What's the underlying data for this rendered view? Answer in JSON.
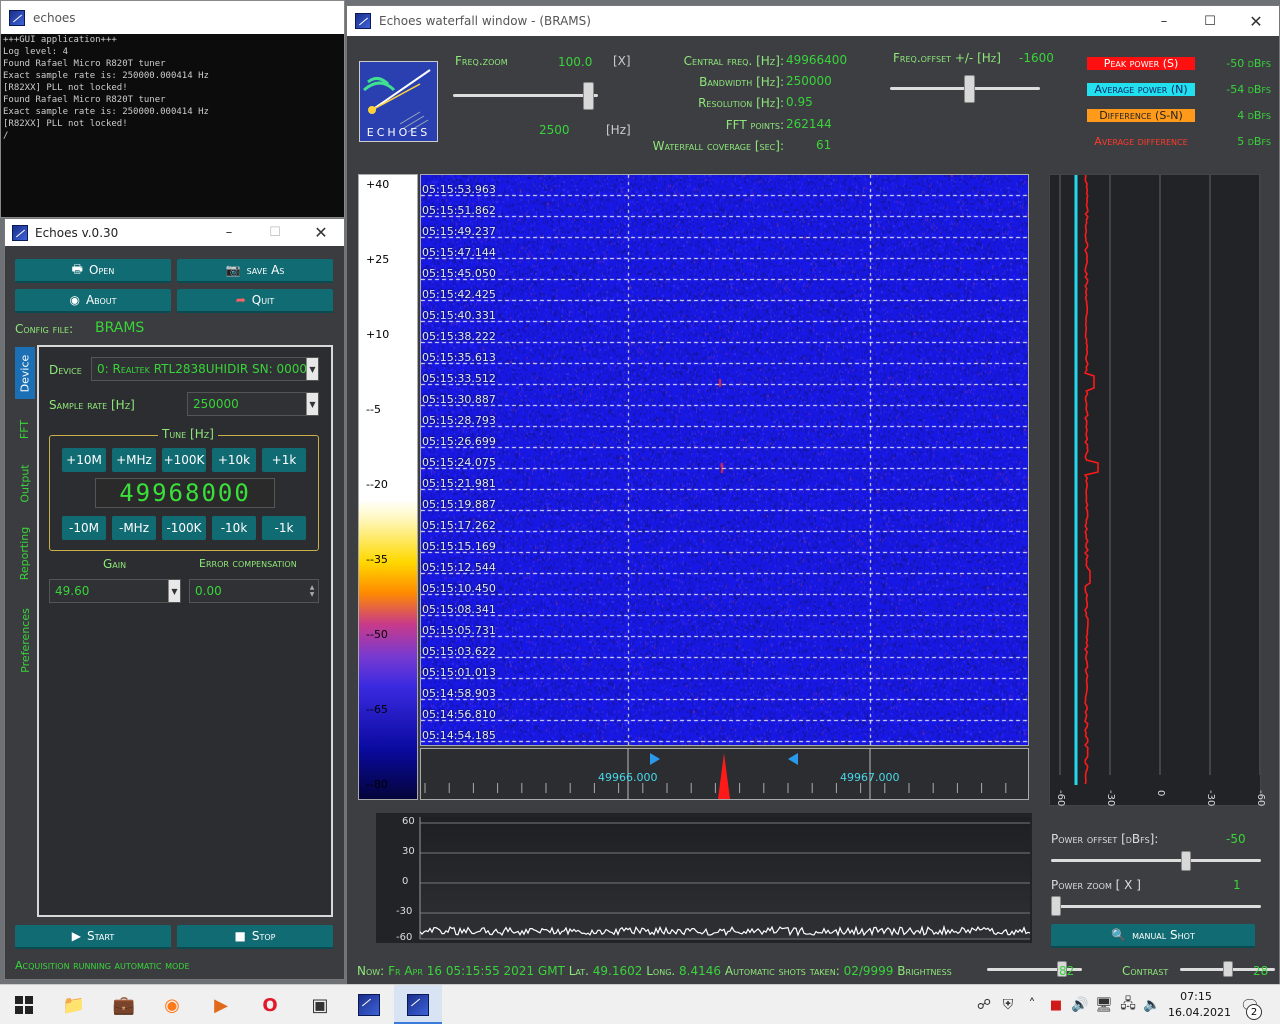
{
  "console": {
    "title": "echoes",
    "lines": [
      "+++GUI application+++",
      "Log level: 4",
      "Found Rafael Micro R820T tuner",
      "Exact sample rate is: 250000.000414 Hz",
      "[R82XX] PLL not locked!",
      "Found Rafael Micro R820T tuner",
      "Exact sample rate is: 250000.000414 Hz",
      "[R82XX] PLL not locked!",
      "/"
    ]
  },
  "control": {
    "title": "Echoes v.0.30",
    "open_label": "Open",
    "saveas_label": "save As",
    "about_label": "About",
    "quit_label": "Quit",
    "config_label": "Config file:",
    "config_value": "BRAMS",
    "tabs": [
      "Device",
      "FFT",
      "Output",
      "Reporting",
      "Preferences"
    ],
    "device_label": "Device",
    "device_value": "0: Realtek RTL2838UHIDIR  SN: 0000",
    "samplerate_label": "Sample rate [Hz]",
    "samplerate_value": "250000",
    "tune_label": "Tune [Hz]",
    "tune_plus": [
      "+10M",
      "+MHz",
      "+100K",
      "+10k",
      "+1k"
    ],
    "tune_minus": [
      "-10M",
      "-MHz",
      "-100K",
      "-10k",
      "-1k"
    ],
    "tune_value": "49968000",
    "gain_label": "Gain",
    "gain_value": "49.60",
    "errcomp_label": "Error compensation",
    "errcomp_value": "0.00",
    "start_label": "Start",
    "stop_label": "Stop",
    "status": "Acquisition running automatic mode"
  },
  "waterfall": {
    "title": "Echoes waterfall window - (BRAMS)",
    "logo_text": "ECHOES",
    "freqzoom_label": "Freq.zoom",
    "freqzoom_value": "100.0",
    "freqzoom_unit": "[X]",
    "freqzoom_hz": "2500",
    "freqzoom_hz_unit": "[Hz]",
    "central_label": "Central freq. [Hz]:",
    "central_value": "49966400",
    "bandwidth_label": "Bandwidth [Hz]:",
    "bandwidth_value": "250000",
    "resolution_label": "Resolution [Hz]:",
    "resolution_value": "0.95",
    "fft_label": "FFT points:",
    "fft_value": "262144",
    "coverage_label": "Waterfall coverage [sec]:",
    "coverage_value": "61",
    "offset_label": "Freq.offset +/- [Hz]",
    "offset_value": "-1600",
    "offset_level": 0.53,
    "freqzoom_level": 0.97,
    "pills": [
      {
        "label": "Peak power (S)",
        "value": "-50 dBfs",
        "bg": "#ff1010",
        "fg": "#ffffff"
      },
      {
        "label": "Average power (N)",
        "value": "-54 dBfs",
        "bg": "#22e0ee",
        "fg": "#0a2a6a"
      },
      {
        "label": "Difference (S-N)",
        "value": "4 dBfs",
        "bg": "#ff9a1a",
        "fg": "#222222"
      },
      {
        "label": "Average difference",
        "value": "5 dBfs",
        "bg": "#3c3e42",
        "fg": "#ff3a2a"
      }
    ],
    "palette_labels": [
      "+40",
      "+25",
      "+10",
      "--5",
      "--20",
      "--35",
      "--50",
      "--65",
      "--80"
    ],
    "timestamps": [
      "05:15:53.963",
      "05:15:51.862",
      "05:15:49.237",
      "05:15:47.144",
      "05:15:45.050",
      "05:15:42.425",
      "05:15:40.331",
      "05:15:38.222",
      "05:15:35.613",
      "05:15:33.512",
      "05:15:30.887",
      "05:15:28.793",
      "05:15:26.699",
      "05:15:24.075",
      "05:15:21.981",
      "05:15:19.887",
      "05:15:17.262",
      "05:15:15.169",
      "05:15:12.544",
      "05:15:10.450",
      "05:15:08.341",
      "05:15:05.731",
      "05:15:03.622",
      "05:15:01.013",
      "05:14:58.903",
      "05:14:56.810",
      "05:14:54.185"
    ],
    "freq_ticks": [
      "49966.000",
      "49967.000"
    ],
    "power_ticks": [
      "-60",
      "-30",
      "0",
      "-30",
      "-60"
    ],
    "spec_ticks": [
      "60",
      "30",
      "0",
      "-30",
      "-60"
    ],
    "poweroffset_label": "Power offset [dBfs]:",
    "poweroffset_value": "-50",
    "poweroffset_level": 0.65,
    "powerzoom_label": "Power zoom  [ X ]",
    "powerzoom_value": "1",
    "powerzoom_level": 0.0,
    "manualshot_label": "manual Shot",
    "status_now_label": "Now:",
    "status_now": "Fr Apr 16 05:15:55 2021 GMT",
    "lat_label": "Lat.",
    "lat": "49.1602",
    "long_label": "Long.",
    "long": "8.4146",
    "shots_label": "Automatic shots taken:",
    "shots": "02/9999",
    "brightness_label": "Brightness",
    "brightness": "82",
    "brightness_level": 0.82,
    "contrast_label": "Contrast",
    "contrast": "28",
    "contrast_level": 0.5
  },
  "taskbar": {
    "time": "07:15",
    "date": "16.04.2021",
    "notif_count": "2"
  }
}
